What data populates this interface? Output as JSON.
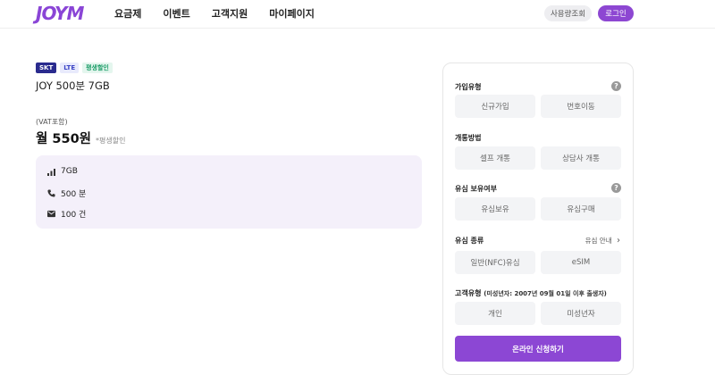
{
  "header": {
    "logo": "JOYM",
    "nav": [
      "요금제",
      "이벤트",
      "고객지원",
      "마이페이지"
    ],
    "usage_label": "사용량조회",
    "login_label": "로그인",
    "brand_color": "#8d47d2"
  },
  "plan": {
    "badges": [
      "SKT",
      "LTE",
      "평생할인"
    ],
    "name": "JOY 500분 7GB",
    "vat": "(VAT포함)",
    "price": "월 550원",
    "price_note": "*평생할인",
    "specs": [
      {
        "icon": "signal-icon",
        "text": "7GB"
      },
      {
        "icon": "phone-icon",
        "text": "500 분"
      },
      {
        "icon": "mail-icon",
        "text": "100 건"
      }
    ]
  },
  "panel": {
    "join_type": {
      "title": "가입유형",
      "options": [
        "신규가입",
        "번호이동"
      ]
    },
    "open_method": {
      "title": "개통방법",
      "options": [
        "셀프 개통",
        "상담사 개통"
      ]
    },
    "usim_own": {
      "title": "유심 보유여부",
      "options": [
        "유심보유",
        "유심구매"
      ]
    },
    "usim_type": {
      "title": "유심 종류",
      "guide": "유심 안내",
      "options": [
        "일반(NFC)유심",
        "eSIM"
      ]
    },
    "customer_type": {
      "title": "고객유형",
      "sub": "(미성년자: 2007년 09월 01일 이후 출생자)",
      "options": [
        "개인",
        "미성년자"
      ]
    },
    "apply_label": "온라인 신청하기",
    "help_glyph": "?",
    "guide_arrow": "›"
  }
}
